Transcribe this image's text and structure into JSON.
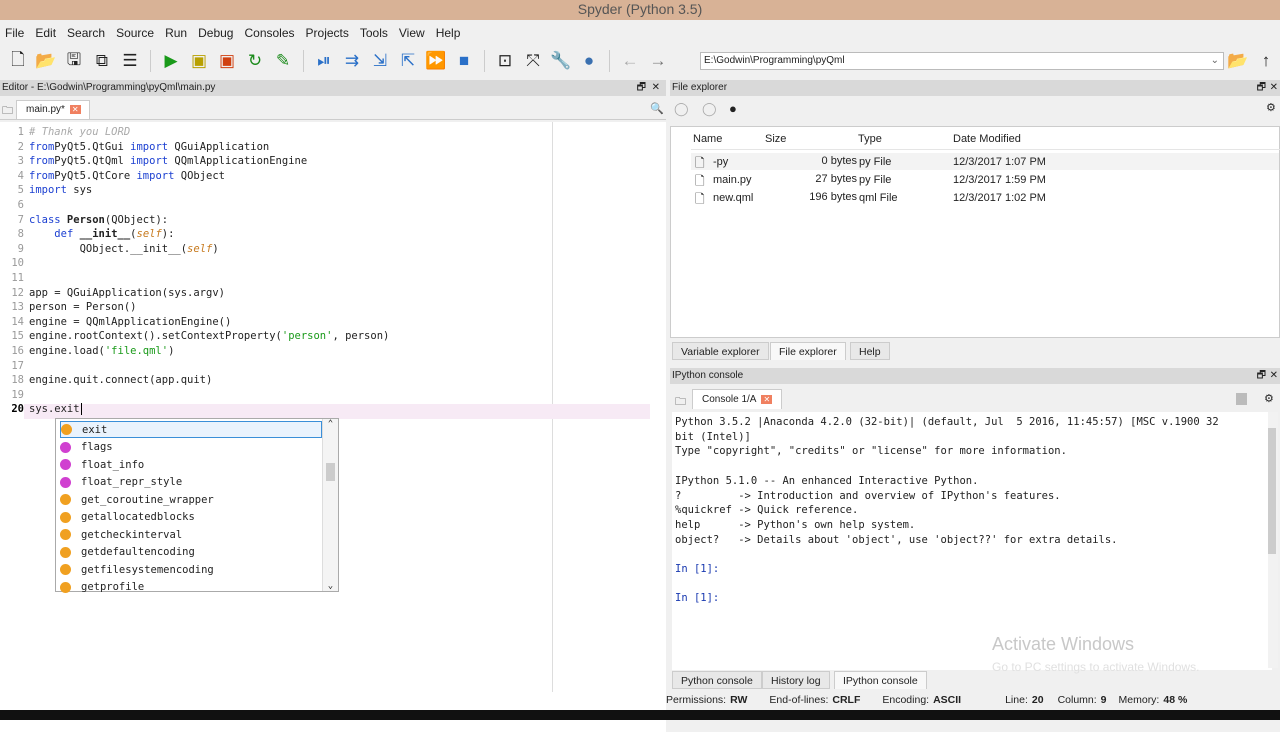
{
  "window": {
    "title": "Spyder (Python 3.5)"
  },
  "menu": [
    "File",
    "Edit",
    "Search",
    "Source",
    "Run",
    "Debug",
    "Consoles",
    "Projects",
    "Tools",
    "View",
    "Help"
  ],
  "toolbar": {
    "path": "E:\\Godwin\\Programming\\pyQml"
  },
  "editor": {
    "header": "Editor - E:\\Godwin\\Programming\\pyQml\\main.py",
    "tab": "main.py*",
    "lines": [
      [
        [
          "cm",
          "# Thank you LORD"
        ]
      ],
      [
        [
          "kw",
          "from"
        ],
        [
          "",
          "PyQt5.QtGui "
        ],
        [
          "kw",
          "import"
        ],
        [
          "",
          " QGuiApplication"
        ]
      ],
      [
        [
          "kw",
          "from"
        ],
        [
          "",
          "PyQt5.QtQml "
        ],
        [
          "kw",
          "import"
        ],
        [
          "",
          " QQmlApplicationEngine"
        ]
      ],
      [
        [
          "kw",
          "from"
        ],
        [
          "",
          "PyQt5.QtCore "
        ],
        [
          "kw",
          "import"
        ],
        [
          "",
          " QObject"
        ]
      ],
      [
        [
          "kw",
          "import"
        ],
        [
          "",
          " sys"
        ]
      ],
      [],
      [
        [
          "kw",
          "class"
        ],
        [
          "bd",
          " Person"
        ],
        [
          "",
          "(QObject):"
        ]
      ],
      [
        [
          "",
          "    "
        ],
        [
          "kw",
          "def"
        ],
        [
          "bd",
          " __init__"
        ],
        [
          "",
          "("
        ],
        [
          "sf",
          "self"
        ],
        [
          "",
          "):"
        ]
      ],
      [
        [
          "",
          "        QObject.__init__("
        ],
        [
          "sf",
          "self"
        ],
        [
          "",
          ")"
        ]
      ],
      [],
      [],
      [
        [
          "",
          "app = QGuiApplication(sys.argv)"
        ]
      ],
      [
        [
          "",
          "person = Person()"
        ]
      ],
      [
        [
          "",
          "engine = QQmlApplicationEngine()"
        ]
      ],
      [
        [
          "",
          "engine.rootContext().setContextProperty("
        ],
        [
          "st",
          "'person'"
        ],
        [
          "",
          ", person)"
        ]
      ],
      [
        [
          "",
          "engine.load("
        ],
        [
          "st",
          "'file.qml'"
        ],
        [
          "",
          ")"
        ]
      ],
      [],
      [
        [
          "",
          "engine.quit.connect(app.quit)"
        ]
      ],
      [],
      [
        [
          "",
          "sys.exit"
        ]
      ]
    ],
    "completions": [
      {
        "label": "exit",
        "color": "#f0a020"
      },
      {
        "label": "flags",
        "color": "#d040d0"
      },
      {
        "label": "float_info",
        "color": "#d040d0"
      },
      {
        "label": "float_repr_style",
        "color": "#d040d0"
      },
      {
        "label": "get_coroutine_wrapper",
        "color": "#f0a020"
      },
      {
        "label": "getallocatedblocks",
        "color": "#f0a020"
      },
      {
        "label": "getcheckinterval",
        "color": "#f0a020"
      },
      {
        "label": "getdefaultencoding",
        "color": "#f0a020"
      },
      {
        "label": "getfilesystemencoding",
        "color": "#f0a020"
      },
      {
        "label": "getprofile",
        "color": "#f0a020"
      }
    ]
  },
  "file_explorer": {
    "title": "File explorer",
    "columns": [
      "Name",
      "Size",
      "Type",
      "Date Modified"
    ],
    "rows": [
      [
        "-py",
        "0 bytes",
        "py File",
        "12/3/2017 1:07 PM"
      ],
      [
        "main.py",
        "27 bytes",
        "py File",
        "12/3/2017 1:59 PM"
      ],
      [
        "new.qml",
        "196 bytes",
        "qml File",
        "12/3/2017 1:02 PM"
      ]
    ],
    "tabs": [
      "Variable explorer",
      "File explorer",
      "Help"
    ]
  },
  "console": {
    "title": "IPython console",
    "tab": "Console 1/A",
    "lines": [
      "Python 3.5.2 |Anaconda 4.2.0 (32-bit)| (default, Jul  5 2016, 11:45:57) [MSC v.1900 32",
      "bit (Intel)]",
      "Type \"copyright\", \"credits\" or \"license\" for more information.",
      "",
      "IPython 5.1.0 -- An enhanced Interactive Python.",
      "?         -> Introduction and overview of IPython's features.",
      "%quickref -> Quick reference.",
      "help      -> Python's own help system.",
      "object?   -> Details about 'object', use 'object??' for extra details.",
      "",
      "In [1]:",
      "",
      "In [1]:"
    ],
    "tabs": [
      "Python console",
      "History log",
      "IPython console"
    ],
    "watermark": "Activate Windows",
    "watermark_sub": "Go to PC settings to activate Windows."
  },
  "status": {
    "permissions_label": "Permissions:",
    "permissions": "RW",
    "eol_label": "End-of-lines:",
    "eol": "CRLF",
    "encoding_label": "Encoding:",
    "encoding": "ASCII",
    "line_label": "Line:",
    "line": "20",
    "column_label": "Column:",
    "column": "9",
    "memory_label": "Memory:",
    "memory": "48 %"
  }
}
